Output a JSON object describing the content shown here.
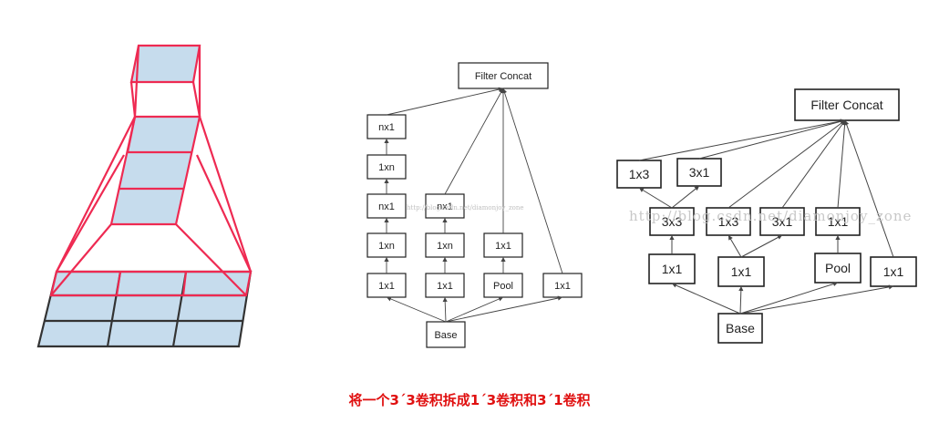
{
  "colors": {
    "caption": "#e01010",
    "cube_edge": "#ee2a52",
    "cube_fill": "#c6dced",
    "grid_edge": "#333333",
    "box_edge": "#222222",
    "line": "#444444"
  },
  "diagram_a": {
    "top": "Filter Concat",
    "bottom": "Base",
    "col1": [
      "1x1",
      "1xn",
      "nx1",
      "1xn",
      "nx1"
    ],
    "col2": [
      "1x1",
      "1xn",
      "nx1"
    ],
    "col3": [
      "Pool",
      "1x1"
    ],
    "col4": [
      "1x1"
    ]
  },
  "diagram_b": {
    "top": "Filter Concat",
    "bottom": "Base",
    "upper": [
      "1x3",
      "3x1"
    ],
    "mid": [
      "3x3",
      "1x3",
      "3x1",
      "1x1"
    ],
    "lower": [
      "1x1",
      "1x1",
      "Pool",
      "1x1"
    ]
  },
  "watermark": "http://blog.csdn.net/diamonjoy_zone",
  "caption": "将一个3´3卷积拆成1´3卷积和3´1卷积"
}
